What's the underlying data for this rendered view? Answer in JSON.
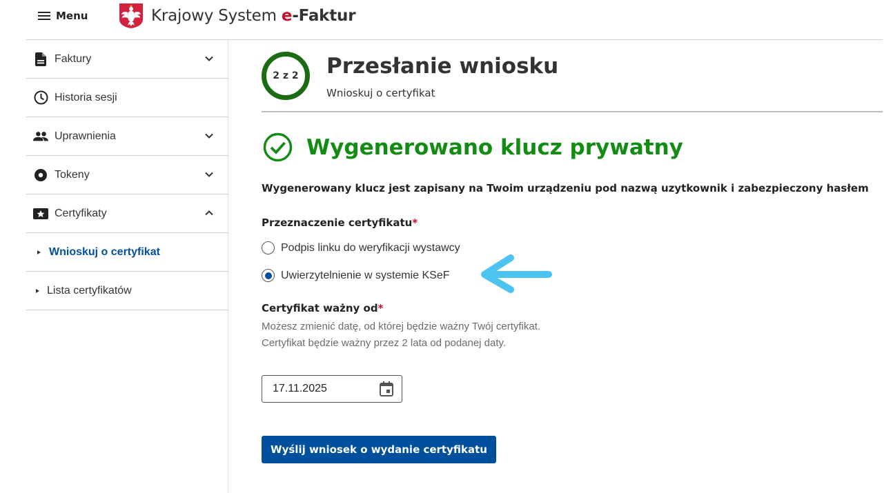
{
  "header": {
    "menu_label": "Menu",
    "brand_prefix": "Krajowy System ",
    "brand_e": "e",
    "brand_rest": "-Faktur"
  },
  "sidebar": {
    "items": [
      {
        "label": "Faktury",
        "icon": "document-icon",
        "chevron": "down"
      },
      {
        "label": "Historia sesji",
        "icon": "clock-icon"
      },
      {
        "label": "Uprawnienia",
        "icon": "people-icon",
        "chevron": "down"
      },
      {
        "label": "Tokeny",
        "icon": "token-icon",
        "chevron": "down"
      },
      {
        "label": "Certyfikaty",
        "icon": "certificate-icon",
        "chevron": "up"
      }
    ],
    "subitems": [
      {
        "label": "Wnioskuj o certyfikat",
        "active": true
      },
      {
        "label": "Lista certyfikatów",
        "active": false
      }
    ]
  },
  "step": {
    "label": "2 z 2",
    "title": "Przesłanie wniosku",
    "subtitle": "Wnioskuj o certyfikat"
  },
  "success_message": "Wygenerowano klucz prywatny",
  "info_text": "Wygenerowany klucz jest zapisany na Twoim urządzeniu pod nazwą uzytkownik i zabezpieczony hasłem",
  "purpose": {
    "label": "Przeznaczenie certyfikatu",
    "required_mark": "*",
    "options": [
      {
        "label": "Podpis linku do weryfikacji wystawcy",
        "checked": false
      },
      {
        "label": "Uwierzytelnienie w systemie KSeF",
        "checked": true
      }
    ]
  },
  "valid_from": {
    "label": "Certyfikat ważny od",
    "required_mark": "*",
    "help": "Możesz zmienić datę, od której będzie ważny Twój certyfikat. Certyfikat będzie ważny przez 2 lata od podanej daty.",
    "value": "17.11.2025"
  },
  "submit_label": "Wyślij wniosek o wydanie certyfikatu",
  "colors": {
    "primary": "#00509e",
    "success": "#138c13",
    "step_ring": "#1a6b12",
    "required": "#c8102e",
    "annotation_arrow": "#4cc3f0"
  }
}
